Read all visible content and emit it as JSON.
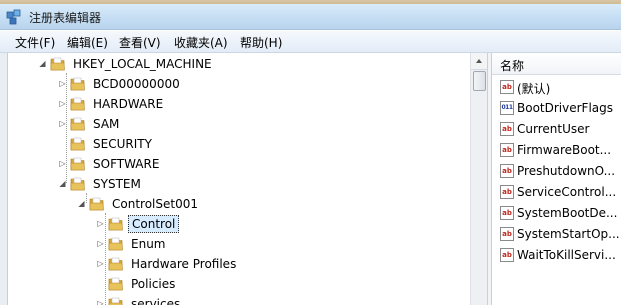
{
  "window": {
    "title": "注册表编辑器",
    "icon": "regedit-icon"
  },
  "menu": [
    {
      "label": "文件(F)"
    },
    {
      "label": "编辑(E)"
    },
    {
      "label": "查看(V)"
    },
    {
      "label": "收藏夹(A)"
    },
    {
      "label": "帮助(H)"
    }
  ],
  "tree": {
    "items": [
      {
        "label": "HKEY_LOCAL_MACHINE",
        "expander": "expanded",
        "depth": 0
      },
      {
        "label": "BCD00000000",
        "expander": "collapsed",
        "depth": 1
      },
      {
        "label": "HARDWARE",
        "expander": "collapsed",
        "depth": 1
      },
      {
        "label": "SAM",
        "expander": "collapsed",
        "depth": 1
      },
      {
        "label": "SECURITY",
        "expander": "none",
        "depth": 1
      },
      {
        "label": "SOFTWARE",
        "expander": "collapsed",
        "depth": 1
      },
      {
        "label": "SYSTEM",
        "expander": "expanded",
        "depth": 1
      },
      {
        "label": "ControlSet001",
        "expander": "expanded",
        "depth": 2
      },
      {
        "label": "Control",
        "expander": "collapsed",
        "depth": 3,
        "selected": true
      },
      {
        "label": "Enum",
        "expander": "collapsed",
        "depth": 3
      },
      {
        "label": "Hardware Profiles",
        "expander": "collapsed",
        "depth": 3
      },
      {
        "label": "Policies",
        "expander": "none",
        "depth": 3
      },
      {
        "label": "services",
        "expander": "collapsed",
        "depth": 3
      }
    ]
  },
  "list": {
    "column_header": "名称",
    "values": [
      {
        "name": "(默认)",
        "type": "string"
      },
      {
        "name": "BootDriverFlags",
        "type": "dword"
      },
      {
        "name": "CurrentUser",
        "type": "string"
      },
      {
        "name": "FirmwareBoot...",
        "type": "string"
      },
      {
        "name": "PreshutdownO...",
        "type": "string"
      },
      {
        "name": "ServiceControl...",
        "type": "string"
      },
      {
        "name": "SystemBootDe...",
        "type": "string"
      },
      {
        "name": "SystemStartOp...",
        "type": "string"
      },
      {
        "name": "WaitToKillServi...",
        "type": "string"
      }
    ]
  },
  "colors": {
    "folder": "#e8c25a",
    "selection": "#d8ecff"
  }
}
